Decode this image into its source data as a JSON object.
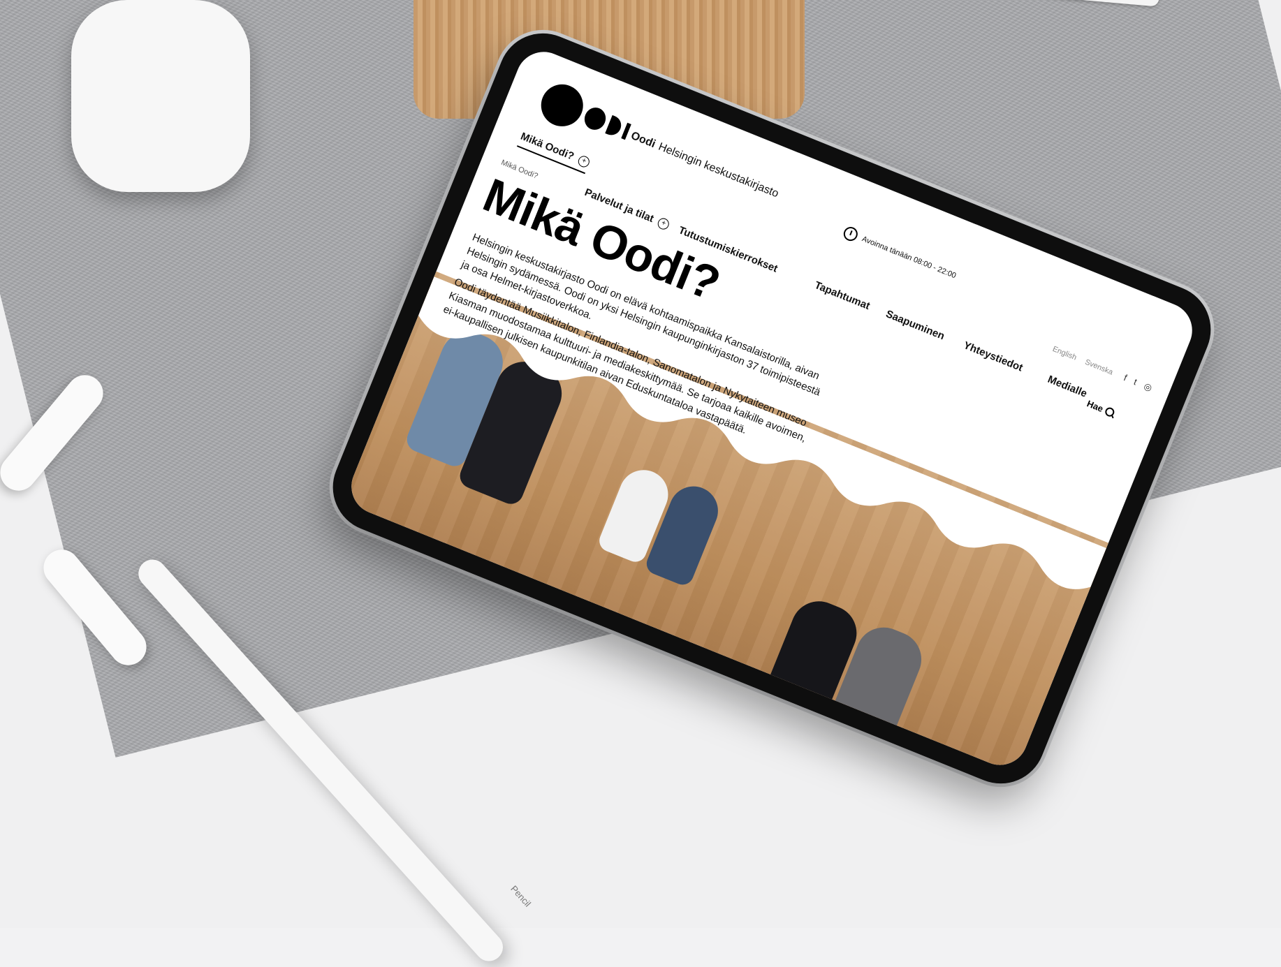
{
  "site": {
    "logo_alt": "Oodi logo",
    "name_bold": "Oodi",
    "name_rest": "Helsingin keskustakirjasto",
    "hours": "Avoinna tänään 08:00 - 22:00"
  },
  "nav": {
    "items": [
      {
        "label": "Mikä Oodi?",
        "expandable": true
      },
      {
        "label": "Palvelut ja tilat",
        "expandable": true
      },
      {
        "label": "Tutustumiskierrokset",
        "expandable": false
      },
      {
        "label": "Tapahtumat",
        "expandable": false
      },
      {
        "label": "Saapuminen",
        "expandable": false
      },
      {
        "label": "Yhteystiedot",
        "expandable": false
      },
      {
        "label": "Medialle",
        "expandable": false
      }
    ]
  },
  "lang": {
    "en": "English",
    "sv": "Svenska"
  },
  "social": {
    "icons": [
      "facebook-icon",
      "twitter-icon",
      "instagram-icon"
    ]
  },
  "search": {
    "label": "Hae"
  },
  "page": {
    "breadcrumb": "Mikä Oodi?",
    "title": "Mikä Oodi?",
    "paragraphs": [
      "Helsingin keskustakirjasto Oodi on elävä kohtaamispaikka Kansalaistorilla, aivan Helsingin sydämessä. Oodi on yksi Helsingin kaupunginkirjaston 37 toimipisteestä ja osa Helmet-kirjastoverkkoa.",
      "Oodi täydentää Musiikkitalon, Finlandia-talon, Sanomatalon ja Nykytaiteen museo Kiasman muodostamaa kulttuuri- ja mediakeskittymää. Se tarjoaa kaikille avoimen, ei-kaupallisen julkisen kaupunkitilan aivan Eduskuntataloa vastapäätä."
    ]
  },
  "pencil": {
    "label": "Pencil"
  },
  "colors": {
    "felt": "#a9aaad",
    "wood": "#cda074",
    "ink": "#000000"
  }
}
